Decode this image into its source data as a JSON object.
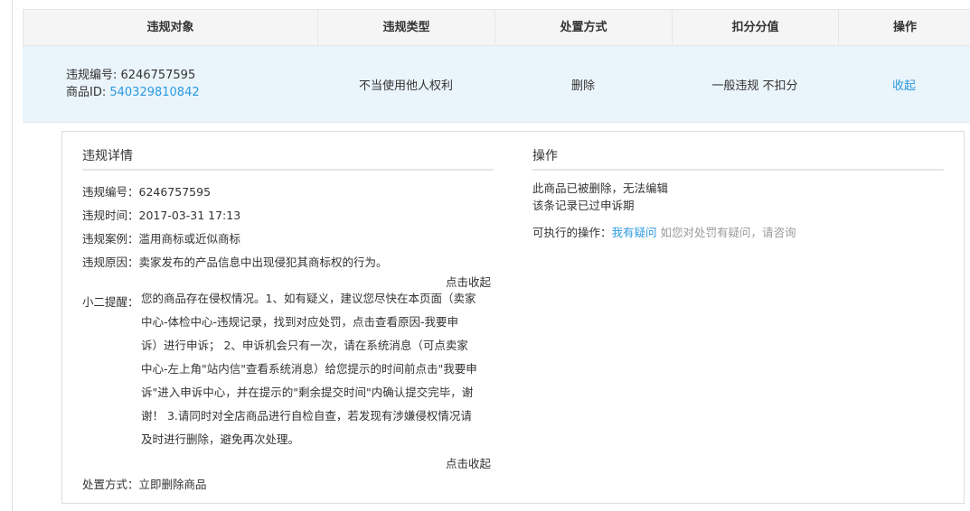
{
  "table": {
    "headers": [
      "违规对象",
      "违规类型",
      "处置方式",
      "扣分分值",
      "操作"
    ],
    "row": {
      "violation_no_label": "违规编号: ",
      "violation_no": "6246757595",
      "item_id_label": "商品ID: ",
      "item_id": "540329810842",
      "type": "不当使用他人权利",
      "handling": "删除",
      "score": "一般违规 不扣分",
      "action": "收起"
    }
  },
  "detail": {
    "title": "违规详情",
    "no": "违规编号：6246757595",
    "time": "违规时间：2017-03-31 17:13",
    "case": "违规案例：滥用商标或近似商标",
    "reason": "违规原因：卖家发布的产品信息中出现侵犯其商标权的行为。",
    "collapse_1": "点击收起",
    "tip_label": "小二提醒：",
    "tip_lines": [
      "您的商品存在侵权情况。1、如有疑义，建议您尽快在本页面（卖家",
      "中心-体检中心-违规记录，找到对应处罚，点击查看原因-我要申",
      "诉）进行申诉； 2、申诉机会只有一次，请在系统消息（可点卖家",
      "中心-左上角\"站内信\"查看系统消息）给您提示的时间前点击\"我要申",
      "诉\"进入申诉中心，并在提示的\"剩余提交时间\"内确认提交完毕，谢",
      "谢！ 3.请同时对全店商品进行自检自查，若发现有涉嫌侵权情况请",
      "及时进行删除，避免再次处理。"
    ],
    "collapse_2": "点击收起",
    "disposal": "处置方式：立即删除商品"
  },
  "operation": {
    "title": "操作",
    "status_1": "此商品已被删除，无法编辑",
    "status_2": "该条记录已过申诉期",
    "available_label": "可执行的操作：",
    "appeal_link": "我有疑问",
    "appeal_hint": "如您对处罚有疑问，请咨询"
  }
}
